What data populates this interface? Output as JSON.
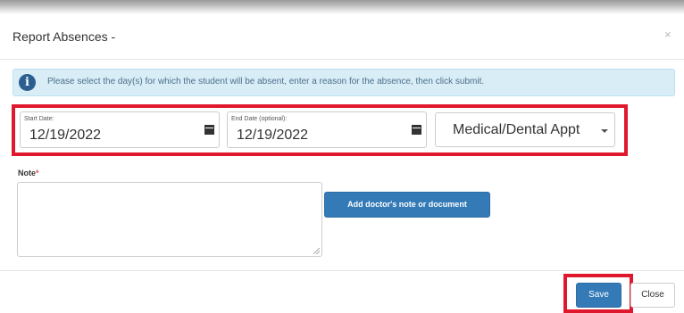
{
  "modal": {
    "title": "Report Absences -",
    "close_glyph": "×"
  },
  "info_alert": {
    "icon": "info-icon",
    "icon_glyph": "i",
    "text": "Please select the day(s) for which the student will be absent, enter a reason for the absence, then click submit."
  },
  "form": {
    "start_date": {
      "label": "Start Date:",
      "value": "12/19/2022",
      "icon": "calendar-icon"
    },
    "end_date": {
      "label": "End Date (optional):",
      "value": "12/19/2022",
      "icon": "calendar-icon"
    },
    "reason": {
      "selected": "Medical/Dental Appt"
    },
    "note": {
      "label": "Note",
      "required_mark": "*",
      "value": ""
    },
    "add_document_label": "Add doctor's note or document"
  },
  "footer": {
    "save_label": "Save",
    "close_label": "Close"
  },
  "colors": {
    "primary": "#337ab7",
    "highlight": "#e0182d",
    "info_bg": "#d9edf7"
  }
}
